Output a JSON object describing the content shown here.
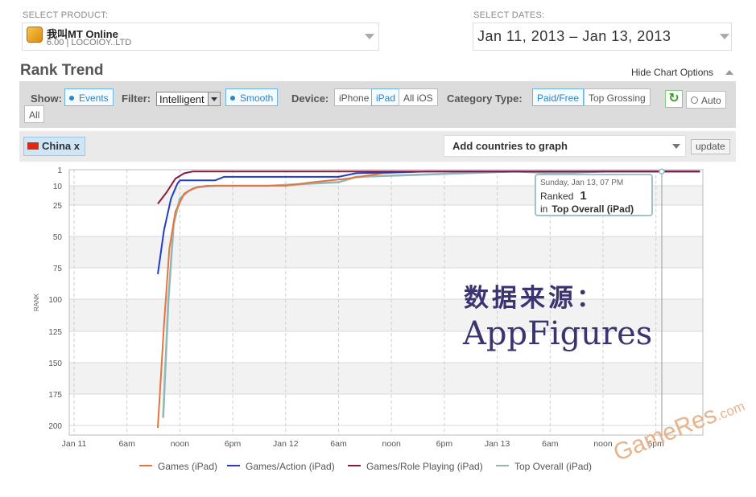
{
  "product": {
    "label": "SELECT PRODUCT:",
    "name": "我叫MT Online",
    "version_publisher": "6.00 | LOCOIOY..LTD"
  },
  "dates": {
    "label": "SELECT DATES:",
    "range": "Jan 11, 2013 – Jan 13, 2013"
  },
  "header": {
    "title": "Rank Trend",
    "hide_options": "Hide Chart Options"
  },
  "toolbar": {
    "show_label": "Show:",
    "events": "Events",
    "filter_label": "Filter:",
    "filter_value": "Intelligent",
    "smooth": "Smooth",
    "device_label": "Device:",
    "devices": [
      "iPhone",
      "iPad",
      "All iOS"
    ],
    "category_label": "Category Type:",
    "categories": [
      "Paid/Free",
      "Top Grossing"
    ],
    "auto": "Auto",
    "all": "All"
  },
  "countries": {
    "chip": "China",
    "chip_close": "x",
    "add_placeholder": "Add countries to graph",
    "update": "update"
  },
  "tooltip": {
    "date": "Sunday, Jan 13, 07 PM",
    "ranked": "Ranked",
    "rank_value": "1",
    "in": "in",
    "category": "Top Overall (iPad)"
  },
  "watermark": {
    "cn": "数据来源：",
    "en": "AppFigures",
    "site": "GameRes",
    "site_suffix": ".com"
  },
  "chart_data": {
    "type": "line",
    "title": "",
    "xlabel": "",
    "ylabel": "RANK",
    "y_inverted": true,
    "ylim": [
      1,
      200
    ],
    "yticks": [
      1,
      10,
      25,
      50,
      75,
      100,
      125,
      150,
      175,
      200
    ],
    "x_unit": "hours since Jan 11 00:00",
    "xlim": [
      0,
      71
    ],
    "xticks": [
      {
        "x": 0,
        "label": "Jan 11"
      },
      {
        "x": 6,
        "label": "6am"
      },
      {
        "x": 12,
        "label": "noon"
      },
      {
        "x": 18,
        "label": "6pm"
      },
      {
        "x": 24,
        "label": "Jan 12"
      },
      {
        "x": 30,
        "label": "6am"
      },
      {
        "x": 36,
        "label": "noon"
      },
      {
        "x": 42,
        "label": "6pm"
      },
      {
        "x": 48,
        "label": "Jan 13"
      },
      {
        "x": 54,
        "label": "6am"
      },
      {
        "x": 60,
        "label": "noon"
      },
      {
        "x": 66,
        "label": "6pm"
      }
    ],
    "grid": true,
    "legend_position": "bottom",
    "series": [
      {
        "name": "Games (iPad)",
        "color": "#e8743b",
        "points": [
          [
            9.5,
            202
          ],
          [
            10.2,
            120
          ],
          [
            10.8,
            60
          ],
          [
            11.5,
            30
          ],
          [
            12.5,
            16
          ],
          [
            13.5,
            12
          ],
          [
            15,
            10
          ],
          [
            20,
            10
          ],
          [
            24,
            10
          ],
          [
            27,
            8
          ],
          [
            31,
            6
          ],
          [
            35,
            3
          ],
          [
            40,
            2
          ],
          [
            48,
            2
          ],
          [
            55,
            2
          ],
          [
            60,
            2
          ],
          [
            71,
            2
          ]
        ]
      },
      {
        "name": "Games/Action (iPad)",
        "color": "#1f3ec9",
        "points": [
          [
            9.5,
            80
          ],
          [
            10.2,
            45
          ],
          [
            11,
            20
          ],
          [
            11.7,
            9
          ],
          [
            12,
            7
          ],
          [
            16,
            7
          ],
          [
            17,
            5
          ],
          [
            30,
            5
          ],
          [
            32,
            3
          ],
          [
            40,
            2
          ],
          [
            55,
            2
          ],
          [
            60,
            2
          ],
          [
            66,
            2
          ],
          [
            71,
            2
          ]
        ]
      },
      {
        "name": "Games/Role Playing (iPad)",
        "color": "#8b1a3c",
        "points": [
          [
            9.5,
            24
          ],
          [
            10.5,
            15
          ],
          [
            11.5,
            6
          ],
          [
            12.5,
            3
          ],
          [
            13.5,
            2
          ],
          [
            20,
            2
          ],
          [
            30,
            2
          ],
          [
            40,
            2
          ],
          [
            55,
            2
          ],
          [
            71,
            2
          ]
        ]
      },
      {
        "name": "Top Overall (iPad)",
        "color": "#8fb9b8",
        "points": [
          [
            10.1,
            194
          ],
          [
            10.7,
            100
          ],
          [
            11.3,
            40
          ],
          [
            12,
            20
          ],
          [
            13,
            14
          ],
          [
            14,
            11
          ],
          [
            16,
            10
          ],
          [
            22,
            10
          ],
          [
            26,
            9
          ],
          [
            30,
            8
          ],
          [
            32,
            5
          ],
          [
            38,
            4
          ],
          [
            44,
            3
          ],
          [
            50,
            2
          ],
          [
            55,
            3
          ],
          [
            60,
            2
          ],
          [
            71,
            2
          ]
        ]
      }
    ]
  }
}
